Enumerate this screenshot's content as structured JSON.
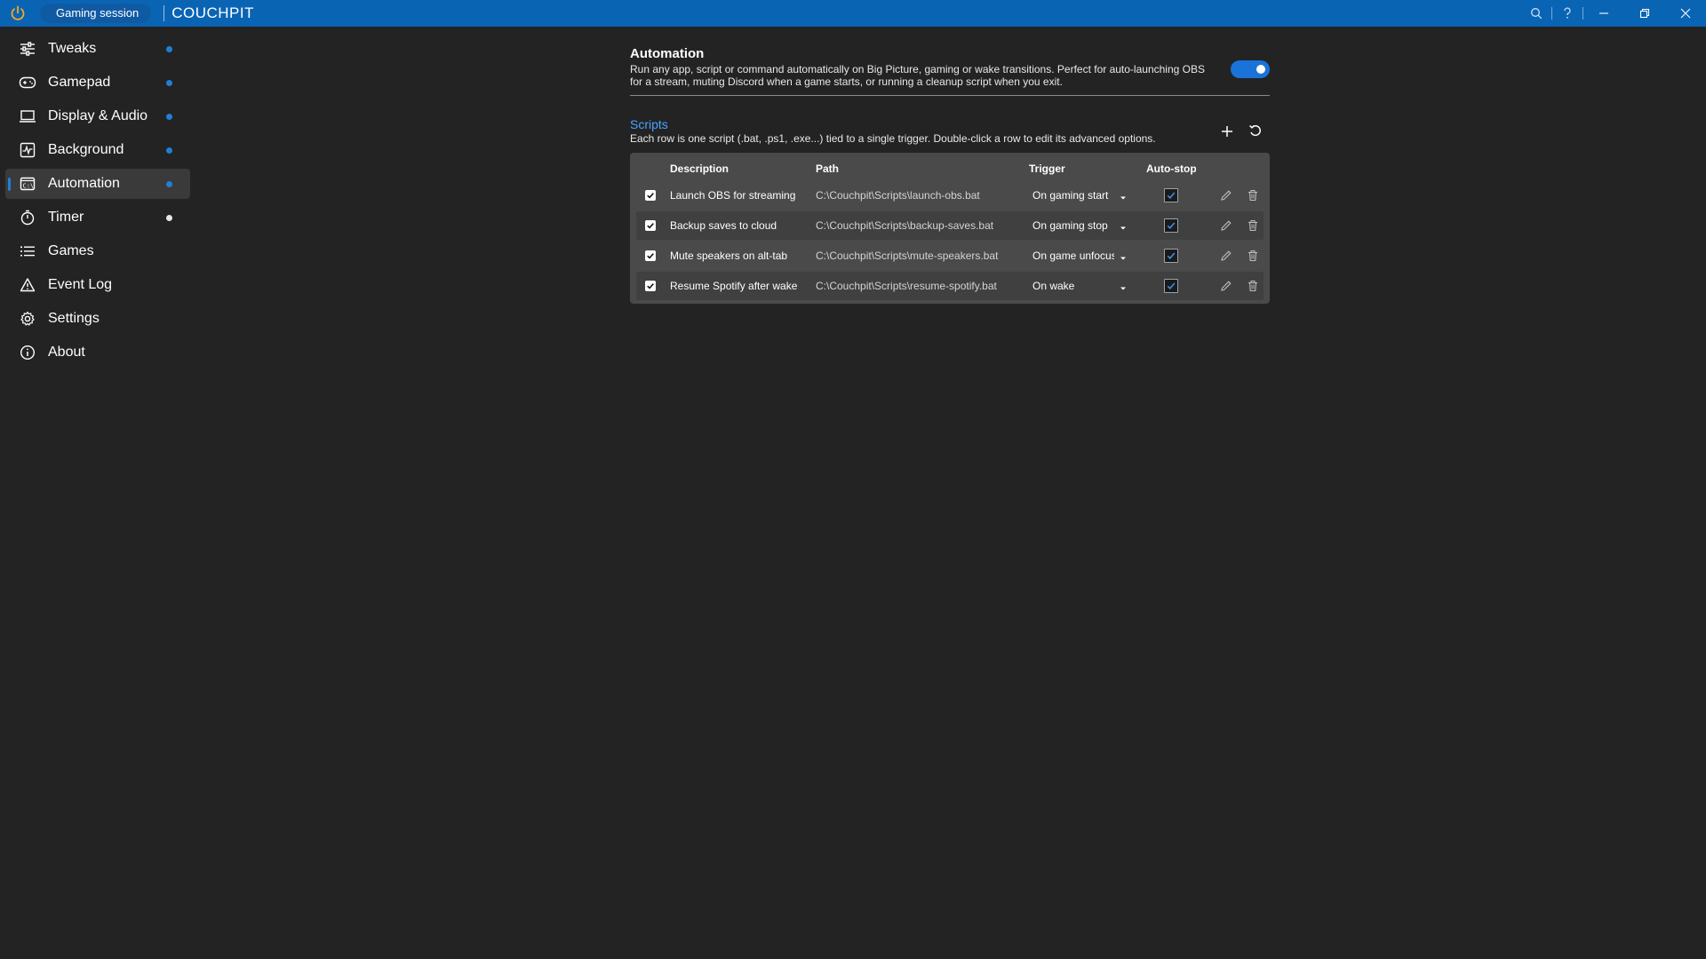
{
  "titlebar": {
    "session_label": "Gaming session",
    "app_title": "COUCHPIT",
    "accent_color": "#0a64b4"
  },
  "sidebar": {
    "items": [
      {
        "label": "Tweaks",
        "icon": "sliders-icon",
        "dot": "blue"
      },
      {
        "label": "Gamepad",
        "icon": "gamepad-icon",
        "dot": "blue"
      },
      {
        "label": "Display & Audio",
        "icon": "monitor-icon",
        "dot": "blue"
      },
      {
        "label": "Background",
        "icon": "activity-icon",
        "dot": "blue"
      },
      {
        "label": "Automation",
        "icon": "terminal-icon",
        "dot": "blue",
        "active": true
      },
      {
        "label": "Timer",
        "icon": "stopwatch-icon",
        "dot": "white"
      },
      {
        "label": "Games",
        "icon": "list-icon"
      },
      {
        "label": "Event Log",
        "icon": "warning-icon"
      },
      {
        "label": "Settings",
        "icon": "gear-icon"
      },
      {
        "label": "About",
        "icon": "info-icon"
      }
    ]
  },
  "automation": {
    "title": "Automation",
    "description": "Run any app, script or command automatically on Big Picture, gaming or wake transitions. Perfect for auto-launching OBS for a stream, muting Discord when a game starts, or running a cleanup script when you exit.",
    "enabled": true
  },
  "scripts": {
    "title": "Scripts",
    "description": "Each row is one script (.bat, .ps1, .exe...) tied to a single trigger. Double-click a row to edit its advanced options.",
    "columns": {
      "description": "Description",
      "path": "Path",
      "trigger": "Trigger",
      "auto_stop": "Auto-stop"
    },
    "rows": [
      {
        "description": "Launch OBS for streaming",
        "path": "C:\\Couchpit\\Scripts\\launch-obs.bat",
        "trigger": "On gaming start",
        "enabled": true,
        "auto_stop": true
      },
      {
        "description": "Backup saves to cloud",
        "path": "C:\\Couchpit\\Scripts\\backup-saves.bat",
        "trigger": "On gaming stop",
        "enabled": true,
        "auto_stop": true
      },
      {
        "description": "Mute speakers on alt-tab",
        "path": "C:\\Couchpit\\Scripts\\mute-speakers.bat",
        "trigger": "On game unfocus",
        "enabled": true,
        "auto_stop": true
      },
      {
        "description": "Resume Spotify after wake",
        "path": "C:\\Couchpit\\Scripts\\resume-spotify.bat",
        "trigger": "On wake",
        "enabled": true,
        "auto_stop": true
      }
    ]
  }
}
